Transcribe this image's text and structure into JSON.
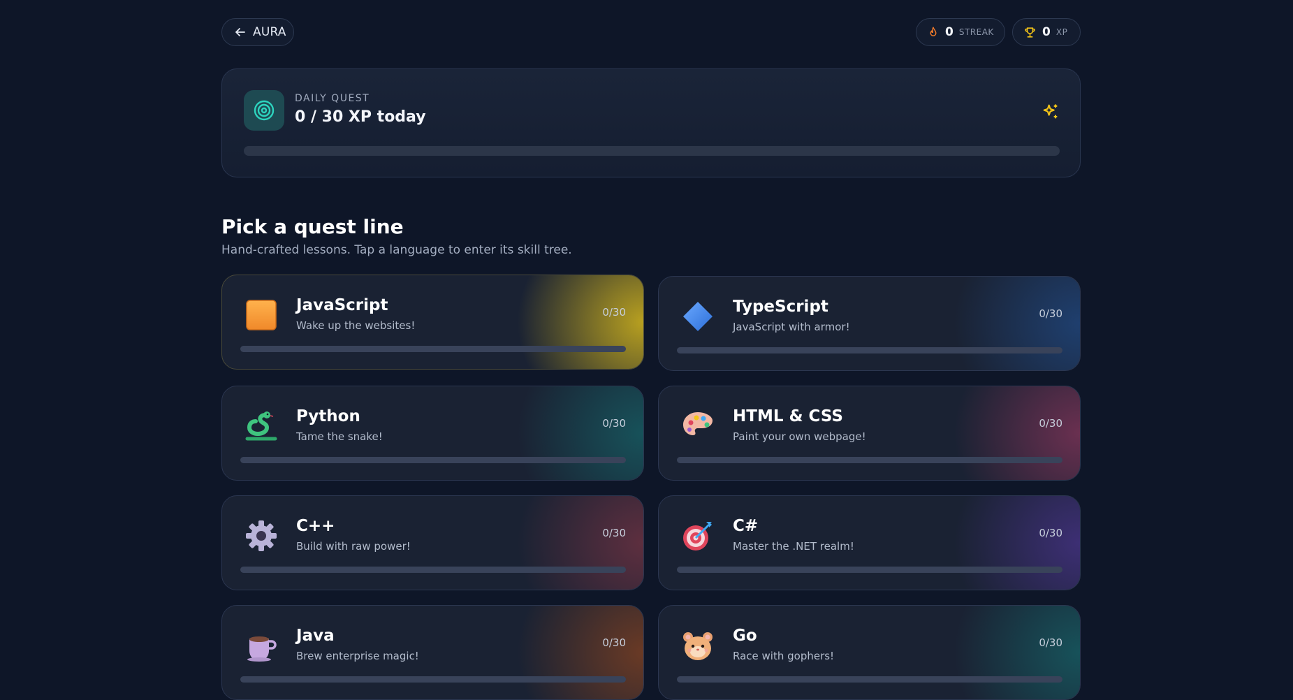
{
  "header": {
    "back_label": "AURA",
    "streak": {
      "value": "0",
      "label": "STREAK"
    },
    "xp": {
      "value": "0",
      "label": "XP"
    }
  },
  "daily_quest": {
    "label": "DAILY QUEST",
    "title": "0 / 30 XP today",
    "progress": 0
  },
  "section": {
    "title": "Pick a quest line",
    "subtitle": "Hand-crafted lessons. Tap a language to enter its skill tree."
  },
  "languages": [
    {
      "name": "JavaScript",
      "tagline": "Wake up the websites!",
      "count": "0/30",
      "progress": 0,
      "icon": "orange-square-icon",
      "accent": "#b8a020"
    },
    {
      "name": "TypeScript",
      "tagline": "JavaScript with armor!",
      "count": "0/30",
      "progress": 0,
      "icon": "blue-diamond-icon",
      "accent": "#1f3f6e"
    },
    {
      "name": "Python",
      "tagline": "Tame the snake!",
      "count": "0/30",
      "progress": 0,
      "icon": "snake-icon",
      "accent": "#17525a"
    },
    {
      "name": "HTML & CSS",
      "tagline": "Paint your own webpage!",
      "count": "0/30",
      "progress": 0,
      "icon": "palette-icon",
      "accent": "#6a3050"
    },
    {
      "name": "C++",
      "tagline": "Build with raw power!",
      "count": "0/30",
      "progress": 0,
      "icon": "gear-icon",
      "accent": "#5e2f3f"
    },
    {
      "name": "C#",
      "tagline": "Master the .NET realm!",
      "count": "0/30",
      "progress": 0,
      "icon": "target-icon",
      "accent": "#3d2f74"
    },
    {
      "name": "Java",
      "tagline": "Brew enterprise magic!",
      "count": "0/30",
      "progress": 0,
      "icon": "coffee-cup-icon",
      "accent": "#6a3a25"
    },
    {
      "name": "Go",
      "tagline": "Race with gophers!",
      "count": "0/30",
      "progress": 0,
      "icon": "hamster-icon",
      "accent": "#17525a"
    }
  ]
}
